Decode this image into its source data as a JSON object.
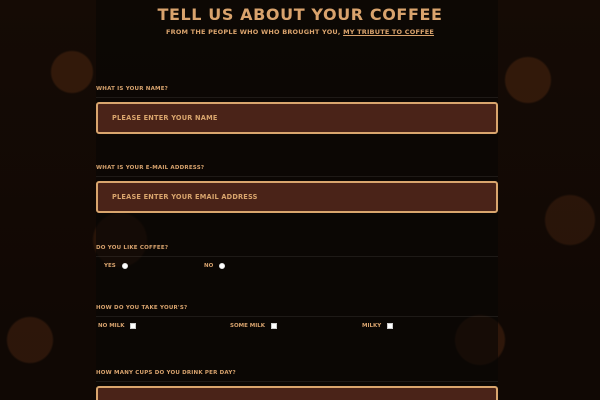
{
  "header": {
    "title": "TELL US ABOUT YOUR COFFEE",
    "subtitle_prefix": "FROM THE PEOPLE WHO WHO BROUGHT YOU,",
    "subtitle_link": "MY TRIBUTE TO COFFEE"
  },
  "form": {
    "name": {
      "label": "WHAT IS YOUR NAME?",
      "placeholder": "PLEASE ENTER YOUR NAME"
    },
    "email": {
      "label": "WHAT IS YOUR E-MAIL ADDRESS?",
      "placeholder": "PLEASE ENTER YOUR EMAIL ADDRESS"
    },
    "like": {
      "label": "DO YOU LIKE COFFEE?",
      "options": [
        "YES",
        "NO"
      ]
    },
    "take": {
      "label": "HOW DO YOU TAKE YOUR'S?",
      "options": [
        "NO MILK",
        "SOME MILK",
        "MILKY"
      ]
    },
    "cups": {
      "label": "HOW MANY CUPS DO YOU DRINK PER DAY?"
    }
  }
}
